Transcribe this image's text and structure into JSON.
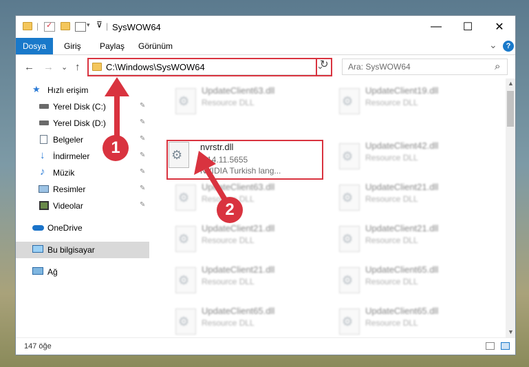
{
  "window": {
    "title": "SysWOW64",
    "minimize": "—",
    "maximize": "☐",
    "close": "✕"
  },
  "ribbon": {
    "tabs": [
      "Dosya",
      "Giriş",
      "Paylaş",
      "Görünüm"
    ],
    "expand": "⌄",
    "help": "?"
  },
  "nav": {
    "back": "←",
    "forward": "→",
    "recent": "⌄",
    "up": "↑",
    "address": "C:\\Windows\\SysWOW64",
    "address_dropdown": "⌄",
    "refresh": "↻",
    "search_placeholder": "Ara: SysWOW64",
    "search_icon": "⌕"
  },
  "sidebar": {
    "items": [
      {
        "label": "Hızlı erişim",
        "icon": "star-icon",
        "pinned": false
      },
      {
        "label": "Yerel Disk (C:)",
        "icon": "drive-icon",
        "pinned": true
      },
      {
        "label": "Yerel Disk (D:)",
        "icon": "drive-icon",
        "pinned": true
      },
      {
        "label": "Belgeler",
        "icon": "document-icon",
        "pinned": true
      },
      {
        "label": "İndirmeler",
        "icon": "download-icon",
        "pinned": true
      },
      {
        "label": "Müzik",
        "icon": "music-icon",
        "pinned": true
      },
      {
        "label": "Resimler",
        "icon": "pictures-icon",
        "pinned": true
      },
      {
        "label": "Videolar",
        "icon": "video-icon",
        "pinned": true
      },
      {
        "label": "OneDrive",
        "icon": "cloud-icon",
        "pinned": false
      },
      {
        "label": "Bu bilgisayar",
        "icon": "computer-icon",
        "pinned": false
      },
      {
        "label": "Ağ",
        "icon": "network-icon",
        "pinned": false
      }
    ],
    "pin_glyph": "📌"
  },
  "files": {
    "left": [
      {
        "name": "UpdateClient63.dll",
        "desc": "Resource DLL"
      },
      {
        "name": "nvrstr.dll",
        "desc": "6.14.11.5655",
        "desc2": "NVIDIA Turkish lang..."
      },
      {
        "name": "UpdateClient63.dll",
        "desc": "Resource DLL"
      },
      {
        "name": "UpdateClient21.dll",
        "desc": "Resource DLL"
      },
      {
        "name": "UpdateClient21.dll",
        "desc": "Resource DLL"
      },
      {
        "name": "UpdateClient65.dll",
        "desc": "Resource DLL"
      }
    ],
    "right": [
      {
        "name": "UpdateClient19.dll",
        "desc": "Resource DLL"
      },
      {
        "name": "UpdateClient42.dll",
        "desc": "Resource DLL"
      },
      {
        "name": "UpdateClient21.dll",
        "desc": "Resource DLL"
      },
      {
        "name": "UpdateClient21.dll",
        "desc": "Resource DLL"
      },
      {
        "name": "UpdateClient65.dll",
        "desc": "Resource DLL"
      },
      {
        "name": "UpdateClient65.dll",
        "desc": "Resource DLL"
      }
    ]
  },
  "status": {
    "count": "147 öğe"
  },
  "callouts": [
    "1",
    "2"
  ],
  "colors": {
    "accent": "#1979ca",
    "highlight": "#d9333f"
  }
}
